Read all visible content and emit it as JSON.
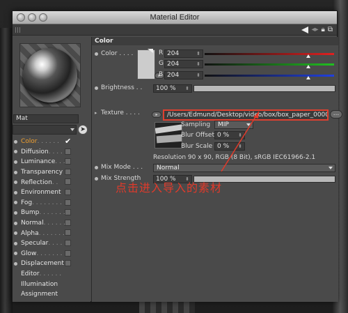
{
  "window": {
    "title": "Material Editor"
  },
  "material": {
    "name": "Mat"
  },
  "channels": [
    {
      "label": "Color",
      "dots": " . . . . . .",
      "checked": true,
      "active": true,
      "bullet": true
    },
    {
      "label": "Diffusion",
      "dots": " . . . .",
      "checked": false,
      "active": false,
      "bullet": true
    },
    {
      "label": "Luminance",
      "dots": " . . .",
      "checked": false,
      "active": false,
      "bullet": true
    },
    {
      "label": "Transparency",
      "dots": "",
      "checked": false,
      "active": false,
      "bullet": true
    },
    {
      "label": "Reflection",
      "dots": " . .",
      "checked": false,
      "active": false,
      "bullet": true
    },
    {
      "label": "Environment",
      "dots": "",
      "checked": false,
      "active": false,
      "bullet": true
    },
    {
      "label": "Fog",
      "dots": " . . . . . . . .",
      "checked": false,
      "active": false,
      "bullet": true
    },
    {
      "label": "Bump",
      "dots": " . . . . . . .",
      "checked": false,
      "active": false,
      "bullet": true
    },
    {
      "label": "Normal",
      "dots": " . . . . . .",
      "checked": false,
      "active": false,
      "bullet": true
    },
    {
      "label": "Alpha",
      "dots": " . . . . . . .",
      "checked": false,
      "active": false,
      "bullet": true
    },
    {
      "label": "Specular",
      "dots": " . . . .",
      "checked": false,
      "active": false,
      "bullet": true
    },
    {
      "label": "Glow",
      "dots": " . . . . . . . .",
      "checked": false,
      "active": false,
      "bullet": true
    },
    {
      "label": "Displacement",
      "dots": "",
      "checked": false,
      "active": false,
      "bullet": true
    },
    {
      "label": "Editor",
      "dots": " . . . . . .",
      "checked": null,
      "active": false,
      "bullet": false
    },
    {
      "label": "Illumination",
      "dots": "",
      "checked": null,
      "active": false,
      "bullet": false
    },
    {
      "label": "Assignment",
      "dots": "",
      "checked": null,
      "active": false,
      "bullet": false
    }
  ],
  "section": {
    "title": "Color"
  },
  "color": {
    "label": "Color . . . .",
    "r_label": "R",
    "g_label": "G",
    "b_label": "B",
    "r": "204",
    "g": "204",
    "b": "204",
    "r_level": 0.8,
    "g_level": 0.8,
    "b_level": 0.8,
    "swatch": "#cccccc"
  },
  "brightness": {
    "label": "Brightness . .",
    "value": "100 %",
    "level": 1.0
  },
  "texture": {
    "label": "Texture . . . .",
    "path": "/Users/Edmund/Desktop/video/box/box_paper_0000",
    "more": "...",
    "sampling_label": "Sampling",
    "sampling_value": "MIP",
    "blur_offset_label": "Blur Offset",
    "blur_offset_value": "0 %",
    "blur_scale_label": "Blur Scale",
    "blur_scale_value": "0 %",
    "resolution": "Resolution 90 x 90, RGB (8 Bit), sRGB IEC61966-2.1"
  },
  "mix_mode": {
    "label": "Mix Mode . . .",
    "value": "Normal"
  },
  "mix_strength": {
    "label": "Mix Strength",
    "value": "100 %",
    "level": 1.0
  },
  "annotation": {
    "text": "点击进入导入的素材",
    "color": "#e23a2a"
  },
  "colors": {
    "highlight": "#e04030",
    "active_channel": "#f0a030"
  }
}
